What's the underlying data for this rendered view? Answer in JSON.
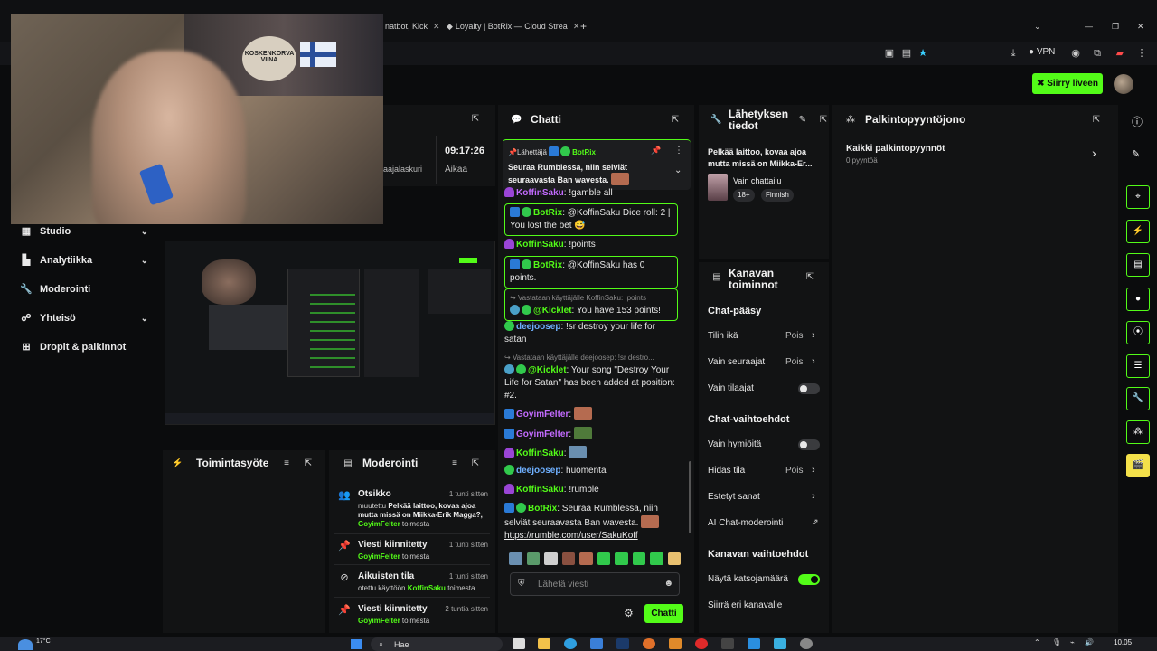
{
  "browser": {
    "tabs": [
      {
        "title": "natbot, Kick"
      },
      {
        "title": "Loyalty | BotRix — Cloud Strea"
      }
    ],
    "new_tab": "+",
    "window_controls": {
      "minimize": "—",
      "maximize": "❐",
      "close": "✕"
    },
    "vpn_label": "VPN"
  },
  "header": {
    "go_live_label": "Siirry liveen"
  },
  "webcam": {
    "badge_text": "KOSKENKORVA VIINA"
  },
  "sidebar": {
    "items": [
      {
        "label": "Studio",
        "icon": "studio-icon",
        "has_chevron": true
      },
      {
        "label": "Analytiikka",
        "icon": "analytics-icon",
        "has_chevron": true
      },
      {
        "label": "Moderointi",
        "icon": "wrench-icon",
        "has_chevron": false
      },
      {
        "label": "Yhteisö",
        "icon": "community-icon",
        "has_chevron": true
      },
      {
        "label": "Dropit & palkinnot",
        "icon": "gift-icon",
        "has_chevron": false
      }
    ]
  },
  "stats_panel": {
    "time": "09:17:26",
    "time_label": "Aikaa",
    "left_label": "aajalaskuri"
  },
  "chat": {
    "title": "Chatti",
    "pinned": {
      "sender_label": "Lähettäjä",
      "sender": "BotRix",
      "text": "Seuraa Rumblessa, niin selviät seuraavasta Ban wavesta.",
      "ellipsis": "..."
    },
    "messages": [
      {
        "user": "KoffinSaku",
        "text": ": !gamble all"
      },
      {
        "user": "BotRix",
        "text": ": @KoffinSaku Dice roll: 2 | You lost the bet 😅"
      },
      {
        "user": "KoffinSaku",
        "text": ": !points"
      },
      {
        "user": "BotRix",
        "text": ": @KoffinSaku has 0 points."
      },
      {
        "reply": "Vastataan käyttäjälle KoffinSaku: !points",
        "user": "@Kicklet",
        "text": ": You have 153 points!"
      },
      {
        "user": "deejoosep",
        "text": ": !sr destroy your life for satan"
      },
      {
        "reply": "Vastataan käyttäjälle deejoosep: !sr destro...",
        "user": "@Kicklet",
        "text": ": Your song \"Destroy Your Life for Satan\" has been added at position: #2."
      },
      {
        "user": "GoyimFelter",
        "text": ":"
      },
      {
        "user": "GoyimFelter",
        "text": ":"
      },
      {
        "user": "KoffinSaku",
        "text": ":"
      },
      {
        "user": "deejoosep",
        "text": ": huomenta"
      },
      {
        "user": "KoffinSaku",
        "text": ": !rumble"
      },
      {
        "user": "BotRix",
        "text": ": Seuraa Rumblessa, niin selviät seuraavasta Ban wavesta.",
        "link": "https://rumble.com/user/SakuKoff"
      }
    ],
    "input_placeholder": "Lähetä viesti",
    "send_label": "Chatti"
  },
  "stream_info": {
    "title": "Lähetyksen tiedot",
    "stream_title": "Pelkää laittoo, kovaa ajoa mutta missä on Miikka-Er...",
    "category": "Vain chattailu",
    "tags": [
      "18+",
      "Finnish"
    ]
  },
  "channel_actions": {
    "title": "Kanavan toiminnot",
    "chat_access_heading": "Chat-pääsy",
    "account_age": {
      "label": "Tilin ikä",
      "value": "Pois"
    },
    "followers_only": {
      "label": "Vain seuraajat",
      "value": "Pois"
    },
    "subscribers_only": {
      "label": "Vain tilaajat"
    },
    "chat_options_heading": "Chat-vaihtoehdot",
    "emotes_only": {
      "label": "Vain hymiöitä"
    },
    "slow_mode": {
      "label": "Hidas tila",
      "value": "Pois"
    },
    "banned_words": {
      "label": "Estetyt sanat"
    },
    "ai_moderation": {
      "label": "AI Chat-moderointi"
    },
    "channel_options_heading": "Kanavan vaihtoehdot",
    "show_viewers": {
      "label": "Näytä katsojamäärä"
    },
    "move_channel": {
      "label": "Siirrä eri kanavalle"
    }
  },
  "rewards": {
    "title": "Palkintopyyntöjono",
    "all_requests": "Kaikki palkintopyynnöt",
    "count": "0 pyyntöä"
  },
  "activity_feed": {
    "title": "Toimintasyöte"
  },
  "moderation": {
    "title": "Moderointi",
    "items": [
      {
        "title": "Otsikko",
        "time": "1 tunti sitten",
        "line1_prefix": "muutettu",
        "line1_bold": "Pelkää laittoo, kovaa ajoa",
        "line2": "mutta missä on Miikka-Erik Magga?,",
        "user": "GoyimFelter",
        "suffix": "toimesta"
      },
      {
        "title": "Viesti kiinnitetty",
        "time": "1 tunti sitten",
        "user": "GoyimFelter",
        "suffix": "toimesta"
      },
      {
        "title": "Aikuisten tila",
        "time": "1 tunti sitten",
        "line1_prefix": "otettu käyttöön",
        "user": "KoffinSaku",
        "suffix": "toimesta"
      },
      {
        "title": "Viesti kiinnitetty",
        "time": "2 tuntia sitten",
        "user": "GoyimFelter",
        "suffix": "toimesta"
      }
    ]
  },
  "taskbar": {
    "weather": "17°C",
    "search_placeholder": "Hae",
    "clock": "10.05"
  }
}
